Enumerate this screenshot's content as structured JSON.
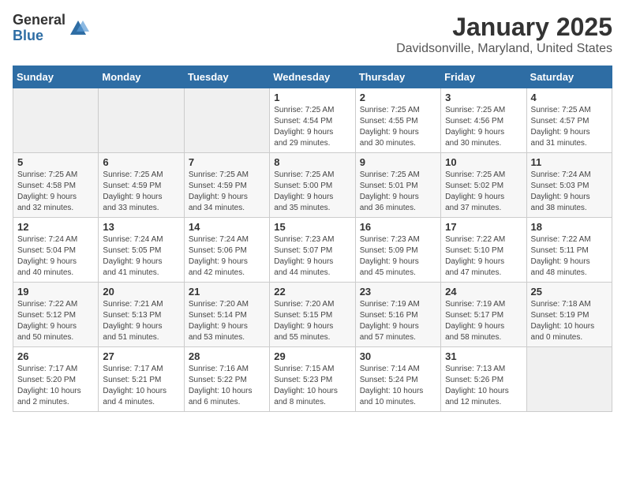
{
  "header": {
    "logo_general": "General",
    "logo_blue": "Blue",
    "month": "January 2025",
    "location": "Davidsonville, Maryland, United States"
  },
  "weekdays": [
    "Sunday",
    "Monday",
    "Tuesday",
    "Wednesday",
    "Thursday",
    "Friday",
    "Saturday"
  ],
  "weeks": [
    [
      {
        "day": "",
        "info": ""
      },
      {
        "day": "",
        "info": ""
      },
      {
        "day": "",
        "info": ""
      },
      {
        "day": "1",
        "info": "Sunrise: 7:25 AM\nSunset: 4:54 PM\nDaylight: 9 hours\nand 29 minutes."
      },
      {
        "day": "2",
        "info": "Sunrise: 7:25 AM\nSunset: 4:55 PM\nDaylight: 9 hours\nand 30 minutes."
      },
      {
        "day": "3",
        "info": "Sunrise: 7:25 AM\nSunset: 4:56 PM\nDaylight: 9 hours\nand 30 minutes."
      },
      {
        "day": "4",
        "info": "Sunrise: 7:25 AM\nSunset: 4:57 PM\nDaylight: 9 hours\nand 31 minutes."
      }
    ],
    [
      {
        "day": "5",
        "info": "Sunrise: 7:25 AM\nSunset: 4:58 PM\nDaylight: 9 hours\nand 32 minutes."
      },
      {
        "day": "6",
        "info": "Sunrise: 7:25 AM\nSunset: 4:59 PM\nDaylight: 9 hours\nand 33 minutes."
      },
      {
        "day": "7",
        "info": "Sunrise: 7:25 AM\nSunset: 4:59 PM\nDaylight: 9 hours\nand 34 minutes."
      },
      {
        "day": "8",
        "info": "Sunrise: 7:25 AM\nSunset: 5:00 PM\nDaylight: 9 hours\nand 35 minutes."
      },
      {
        "day": "9",
        "info": "Sunrise: 7:25 AM\nSunset: 5:01 PM\nDaylight: 9 hours\nand 36 minutes."
      },
      {
        "day": "10",
        "info": "Sunrise: 7:25 AM\nSunset: 5:02 PM\nDaylight: 9 hours\nand 37 minutes."
      },
      {
        "day": "11",
        "info": "Sunrise: 7:24 AM\nSunset: 5:03 PM\nDaylight: 9 hours\nand 38 minutes."
      }
    ],
    [
      {
        "day": "12",
        "info": "Sunrise: 7:24 AM\nSunset: 5:04 PM\nDaylight: 9 hours\nand 40 minutes."
      },
      {
        "day": "13",
        "info": "Sunrise: 7:24 AM\nSunset: 5:05 PM\nDaylight: 9 hours\nand 41 minutes."
      },
      {
        "day": "14",
        "info": "Sunrise: 7:24 AM\nSunset: 5:06 PM\nDaylight: 9 hours\nand 42 minutes."
      },
      {
        "day": "15",
        "info": "Sunrise: 7:23 AM\nSunset: 5:07 PM\nDaylight: 9 hours\nand 44 minutes."
      },
      {
        "day": "16",
        "info": "Sunrise: 7:23 AM\nSunset: 5:09 PM\nDaylight: 9 hours\nand 45 minutes."
      },
      {
        "day": "17",
        "info": "Sunrise: 7:22 AM\nSunset: 5:10 PM\nDaylight: 9 hours\nand 47 minutes."
      },
      {
        "day": "18",
        "info": "Sunrise: 7:22 AM\nSunset: 5:11 PM\nDaylight: 9 hours\nand 48 minutes."
      }
    ],
    [
      {
        "day": "19",
        "info": "Sunrise: 7:22 AM\nSunset: 5:12 PM\nDaylight: 9 hours\nand 50 minutes."
      },
      {
        "day": "20",
        "info": "Sunrise: 7:21 AM\nSunset: 5:13 PM\nDaylight: 9 hours\nand 51 minutes."
      },
      {
        "day": "21",
        "info": "Sunrise: 7:20 AM\nSunset: 5:14 PM\nDaylight: 9 hours\nand 53 minutes."
      },
      {
        "day": "22",
        "info": "Sunrise: 7:20 AM\nSunset: 5:15 PM\nDaylight: 9 hours\nand 55 minutes."
      },
      {
        "day": "23",
        "info": "Sunrise: 7:19 AM\nSunset: 5:16 PM\nDaylight: 9 hours\nand 57 minutes."
      },
      {
        "day": "24",
        "info": "Sunrise: 7:19 AM\nSunset: 5:17 PM\nDaylight: 9 hours\nand 58 minutes."
      },
      {
        "day": "25",
        "info": "Sunrise: 7:18 AM\nSunset: 5:19 PM\nDaylight: 10 hours\nand 0 minutes."
      }
    ],
    [
      {
        "day": "26",
        "info": "Sunrise: 7:17 AM\nSunset: 5:20 PM\nDaylight: 10 hours\nand 2 minutes."
      },
      {
        "day": "27",
        "info": "Sunrise: 7:17 AM\nSunset: 5:21 PM\nDaylight: 10 hours\nand 4 minutes."
      },
      {
        "day": "28",
        "info": "Sunrise: 7:16 AM\nSunset: 5:22 PM\nDaylight: 10 hours\nand 6 minutes."
      },
      {
        "day": "29",
        "info": "Sunrise: 7:15 AM\nSunset: 5:23 PM\nDaylight: 10 hours\nand 8 minutes."
      },
      {
        "day": "30",
        "info": "Sunrise: 7:14 AM\nSunset: 5:24 PM\nDaylight: 10 hours\nand 10 minutes."
      },
      {
        "day": "31",
        "info": "Sunrise: 7:13 AM\nSunset: 5:26 PM\nDaylight: 10 hours\nand 12 minutes."
      },
      {
        "day": "",
        "info": ""
      }
    ]
  ]
}
